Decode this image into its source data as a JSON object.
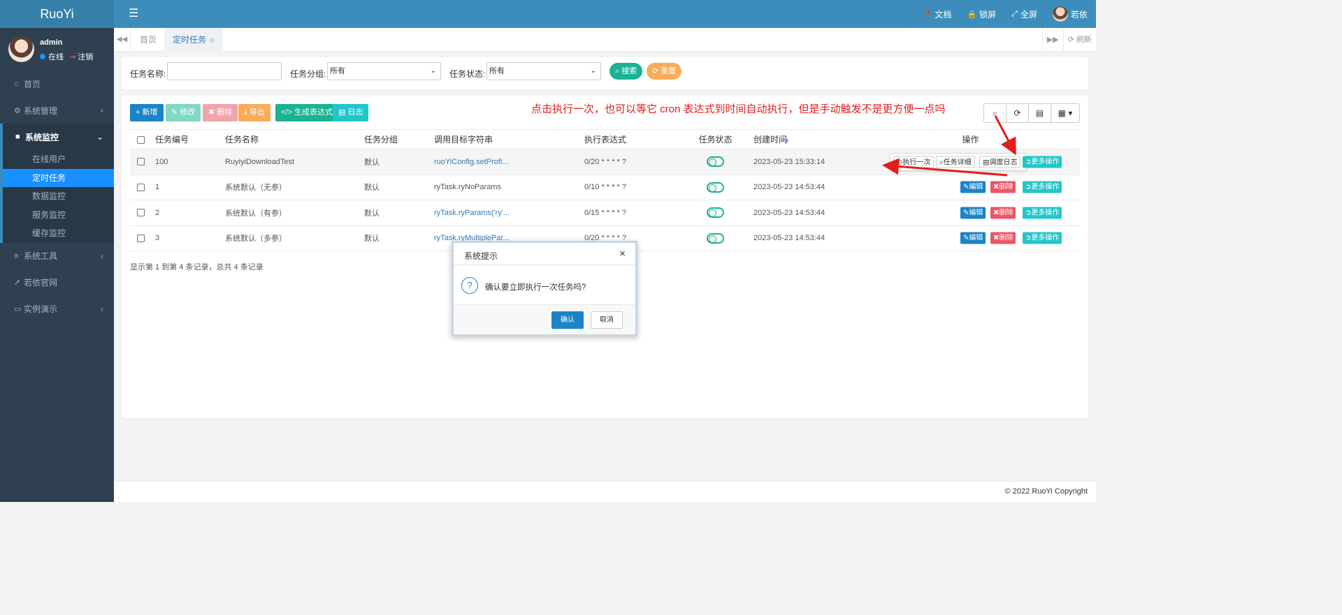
{
  "app": {
    "logo": "RuoYi"
  },
  "topnav": {
    "docs": "文档",
    "lock": "锁屏",
    "fullscreen": "全屏",
    "user": "若依"
  },
  "user": {
    "name": "admin",
    "online": "在线",
    "logout": "注销"
  },
  "sidebar": {
    "home": "首页",
    "system_mgmt": "系统管理",
    "monitor": "系统监控",
    "monitor_items": [
      "在线用户",
      "定时任务",
      "数据监控",
      "服务监控",
      "缓存监控"
    ],
    "tools": "系统工具",
    "website": "若依官网",
    "demo": "实例演示"
  },
  "tabs": {
    "home": "首页",
    "active": "定时任务",
    "refresh": "刷新"
  },
  "search": {
    "task_name_label": "任务名称:",
    "task_name_value": "",
    "group_label": "任务分组:",
    "group_value": "所有",
    "status_label": "任务状态:",
    "status_value": "所有",
    "search_btn": "搜索",
    "reset_btn": "重置"
  },
  "toolbar": {
    "add": "新增",
    "edit": "修改",
    "delete": "删除",
    "export": "导出",
    "cron": "生成表达式",
    "log": "日志"
  },
  "annotation": "点击执行一次，也可以等它 cron 表达式到时间自动执行，但是手动触发不是更方便一点吗",
  "table": {
    "headers": [
      "任务编号",
      "任务名称",
      "任务分组",
      "调用目标字符串",
      "执行表达式",
      "任务状态",
      "创建时间",
      "操作"
    ],
    "rows": [
      {
        "id": "100",
        "name": "RuyiyiDownloadTest",
        "group": "默认",
        "target": "ruoYiConfig.setProfi...",
        "cron": "0/20 * * * * ?",
        "created": "2023-05-23 15:33:14"
      },
      {
        "id": "1",
        "name": "系统默认（无参）",
        "group": "默认",
        "target": "ryTask.ryNoParams",
        "cron": "0/10 * * * * ?",
        "created": "2023-05-23 14:53:44"
      },
      {
        "id": "2",
        "name": "系统默认（有参）",
        "group": "默认",
        "target": "ryTask.ryParams('ry'...",
        "cron": "0/15 * * * * ?",
        "created": "2023-05-23 14:53:44"
      },
      {
        "id": "3",
        "name": "系统默认（多参）",
        "group": "默认",
        "target": "ryTask.ryMultiplePar...",
        "cron": "0/20 * * * * ?",
        "created": "2023-05-23 14:53:44"
      }
    ],
    "ops": {
      "edit": "编辑",
      "delete": "删除",
      "more": "更多操作",
      "run_once": "执行一次",
      "detail": "任务详细",
      "schedule_log": "调度日志"
    },
    "pagination": "显示第 1 到第 4 条记录，总共 4 条记录"
  },
  "modal": {
    "title": "系统提示",
    "message": "确认要立即执行一次任务吗?",
    "ok": "确认",
    "cancel": "取消"
  },
  "footer": {
    "copyright": "© 2022 RuoYi Copyright"
  },
  "colors": {
    "brand": "#3c8dbc",
    "sidebar": "#2f4050",
    "active": "#1890ff",
    "annotation": "#e21d1d"
  }
}
